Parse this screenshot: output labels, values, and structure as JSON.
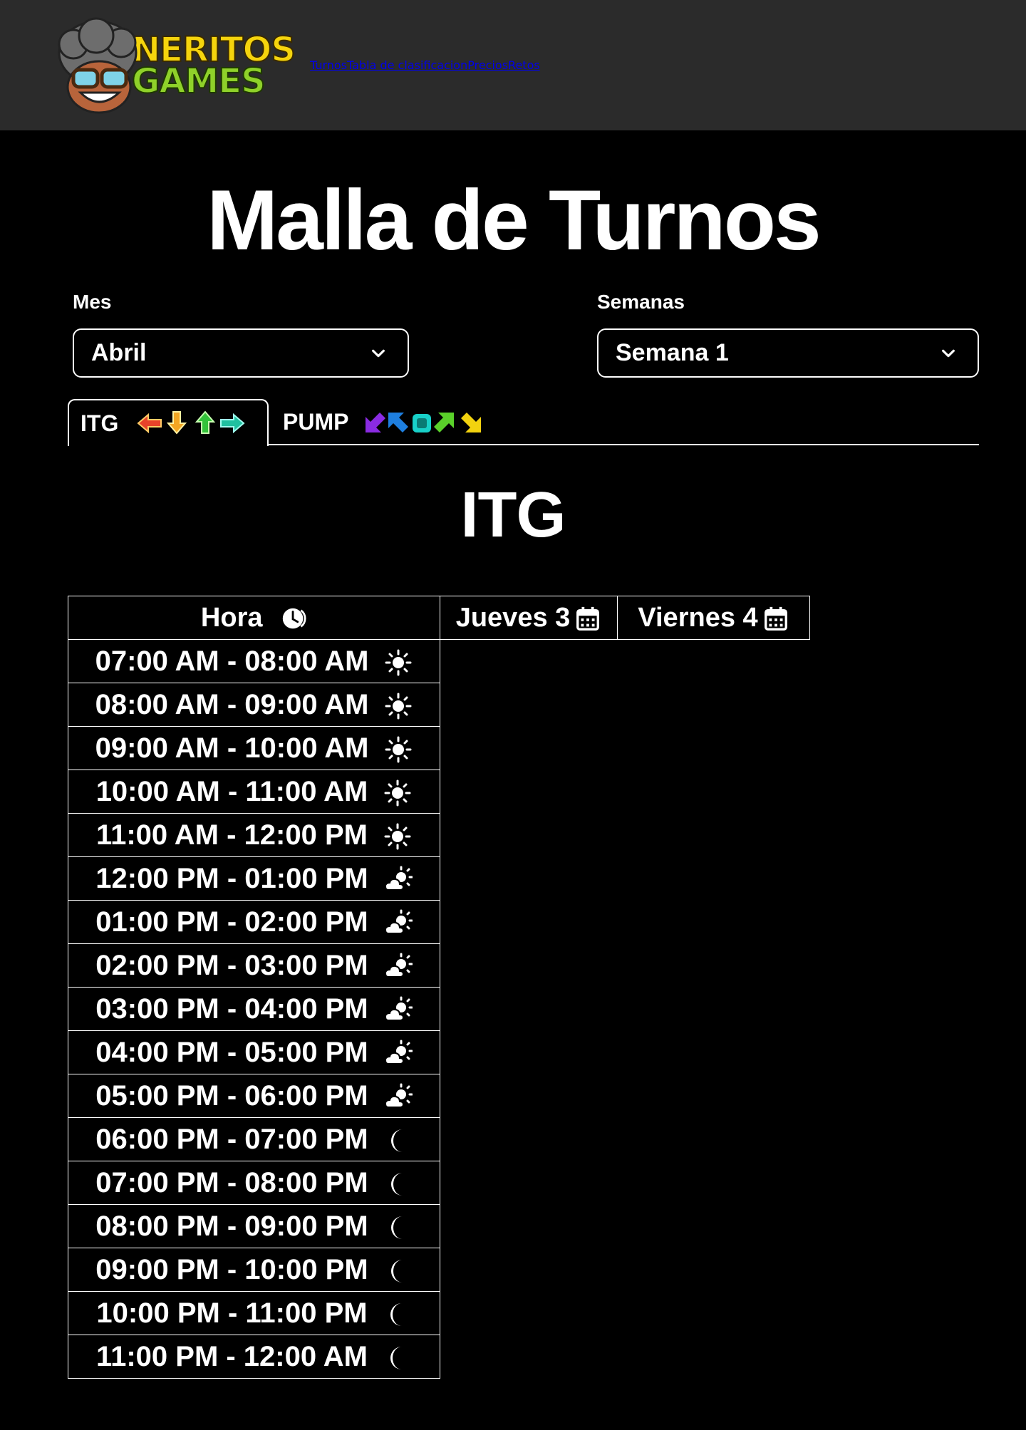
{
  "nav": {
    "logo": {
      "line1": "NERITOS",
      "line2": "GAMES"
    },
    "links": [
      "Turnos",
      "Tabla de clasificacion",
      "Precios",
      "Retos"
    ]
  },
  "page_title": "Malla de Turnos",
  "filters": {
    "month_label": "Mes",
    "month_value": "Abril",
    "week_label": "Semanas",
    "week_value": "Semana 1"
  },
  "tabs": [
    {
      "label": "ITG",
      "active": true
    },
    {
      "label": "PUMP",
      "active": false
    }
  ],
  "section_title": "ITG",
  "schedule": {
    "hour_header": "Hora",
    "days": [
      "Jueves 3",
      "Viernes 4"
    ],
    "slots": [
      {
        "time": "07:00 AM - 08:00 AM",
        "icon": "sun-icon"
      },
      {
        "time": "08:00 AM - 09:00 AM",
        "icon": "sun-icon"
      },
      {
        "time": "09:00 AM - 10:00 AM",
        "icon": "sun-icon"
      },
      {
        "time": "10:00 AM - 11:00 AM",
        "icon": "sun-icon"
      },
      {
        "time": "11:00 AM - 12:00 PM",
        "icon": "sun-icon"
      },
      {
        "time": "12:00 PM - 01:00 PM",
        "icon": "cloud-sun-icon"
      },
      {
        "time": "01:00 PM - 02:00 PM",
        "icon": "cloud-sun-icon"
      },
      {
        "time": "02:00 PM - 03:00 PM",
        "icon": "cloud-sun-icon"
      },
      {
        "time": "03:00 PM - 04:00 PM",
        "icon": "cloud-sun-icon"
      },
      {
        "time": "04:00 PM - 05:00 PM",
        "icon": "cloud-sun-icon"
      },
      {
        "time": "05:00 PM - 06:00 PM",
        "icon": "cloud-sun-icon"
      },
      {
        "time": "06:00 PM - 07:00 PM",
        "icon": "moon-icon"
      },
      {
        "time": "07:00 PM - 08:00 PM",
        "icon": "moon-icon"
      },
      {
        "time": "08:00 PM - 09:00 PM",
        "icon": "moon-icon"
      },
      {
        "time": "09:00 PM - 10:00 PM",
        "icon": "moon-icon"
      },
      {
        "time": "10:00 PM - 11:00 PM",
        "icon": "moon-icon"
      },
      {
        "time": "11:00 PM - 12:00 AM",
        "icon": "moon-icon"
      }
    ]
  }
}
